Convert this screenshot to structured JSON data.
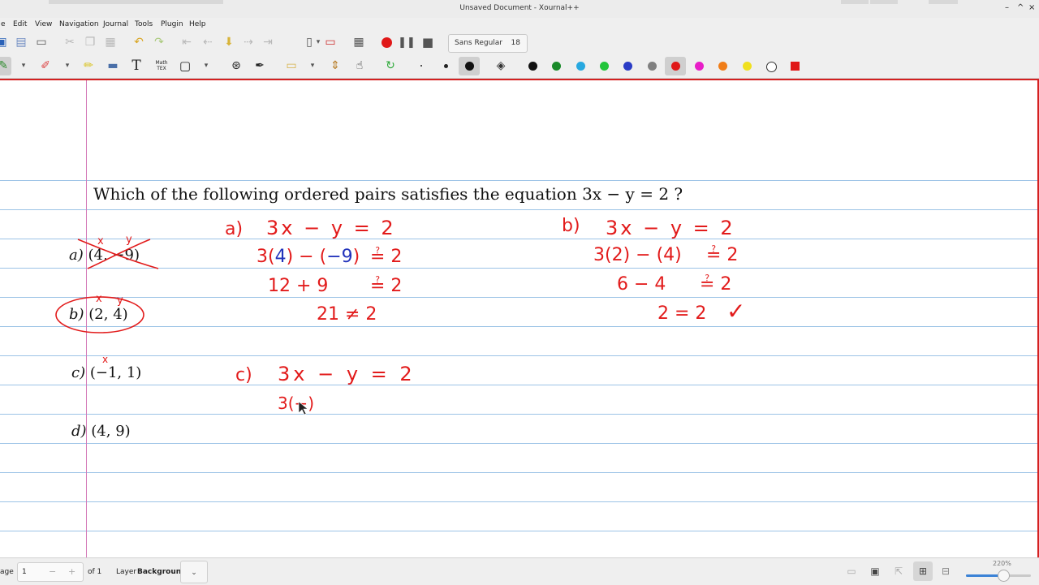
{
  "window": {
    "title": "Unsaved Document - Xournal++"
  },
  "menu": [
    "e",
    "Edit",
    "View",
    "Navigation",
    "Journal",
    "Tools",
    "Plugin",
    "Help"
  ],
  "toolbar": {
    "font_name": "Sans Regular",
    "font_size": "18",
    "tex_label_1": "Math",
    "tex_label_2": "TEX",
    "colors": [
      "#111111",
      "#1a8a2a",
      "#27a8e0",
      "#22c43a",
      "#2a3cc6",
      "#808080",
      "#e01818",
      "#e81ec8",
      "#f07d18",
      "#f0e01e",
      "#ffffff",
      "#e01818"
    ],
    "selected_color_index": 6
  },
  "document": {
    "question": "Which of the following ordered pairs satisfies the equation 3x − y = 2 ?",
    "options": [
      {
        "label": "a)",
        "pair": "(4, −9)"
      },
      {
        "label": "b)",
        "pair": "(2, 4)"
      },
      {
        "label": "c)",
        "pair": "(−1, 1)"
      },
      {
        "label": "d)",
        "pair": "(4, 9)"
      }
    ],
    "handwriting": {
      "a_header": "a)",
      "a_line1": "3x − y = 2",
      "a_line2_pre": "3(",
      "a_line2_4": "4",
      "a_line2_mid": ") − (",
      "a_line2_neg9": "−9",
      "a_line2_post": ")",
      "a_line2_eq": "≟ 2",
      "a_line3": "12 + 9",
      "a_line3_eq": "≟ 2",
      "a_line4": "21 ≠ 2",
      "b_header": "b)",
      "b_line1": "3x − y = 2",
      "b_line2": "3(2) − (4)",
      "b_line2_eq": "≟ 2",
      "b_line3": "6 − 4",
      "b_line3_eq": "≟ 2",
      "b_line4": "2 = 2",
      "b_check": "✓",
      "c_header": "c)",
      "c_line1": "3x − y = 2",
      "c_line2": "3(−)",
      "mark_x": "x",
      "mark_y": "y"
    }
  },
  "statusbar": {
    "page_label": "age",
    "page_value": "1",
    "page_minus": "−",
    "page_plus": "+",
    "of_label": "of 1",
    "layer_label": "Layer",
    "layer_value": "Background",
    "layer_dropdown": "⌄",
    "zoom": "220%",
    "zoom_fraction": 0.58
  }
}
